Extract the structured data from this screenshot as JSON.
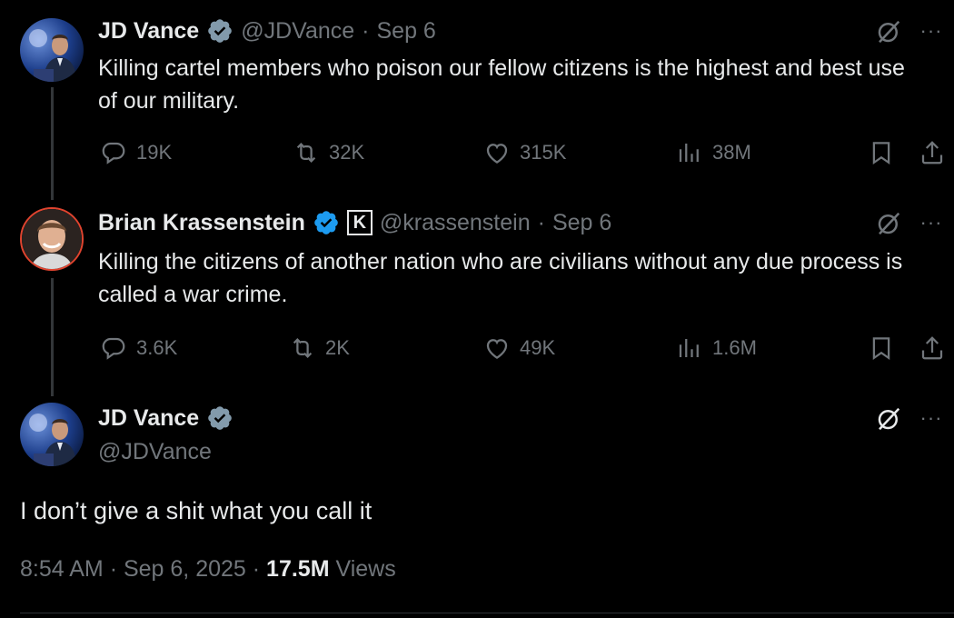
{
  "colors": {
    "background": "#000000",
    "text_primary": "#e7e9ea",
    "text_secondary": "#71767b",
    "verified_blue": "#1d9bf0",
    "verified_gray": "#829aab"
  },
  "tweets": [
    {
      "author_name": "JD Vance",
      "handle": "@JDVance",
      "separator": "·",
      "date": "Sep 6",
      "text": "Killing cartel members who poison our fellow citizens is the highest and best use of our military.",
      "replies": "19K",
      "retweets": "32K",
      "likes": "315K",
      "views": "38M"
    },
    {
      "author_name": "Brian Krassenstein",
      "handle": "@krassenstein",
      "separator": "·",
      "date": "Sep 6",
      "affiliate_badge": "K",
      "text": "Killing the citizens of another nation who are civilians without any due process is called a war crime.",
      "replies": "3.6K",
      "retweets": "2K",
      "likes": "49K",
      "views": "1.6M"
    }
  ],
  "main_tweet": {
    "author_name": "JD Vance",
    "handle": "@JDVance",
    "text": "I don’t give a shit what you call it",
    "time": "8:54 AM",
    "dot1": "·",
    "date": "Sep 6, 2025",
    "dot2": "·",
    "views_count": "17.5M",
    "views_label": "Views"
  },
  "icons": {
    "reply": "reply-icon",
    "retweet": "retweet-icon",
    "like": "heart-icon",
    "views": "views-icon",
    "bookmark": "bookmark-icon",
    "share": "share-icon",
    "grok": "grok-icon",
    "more": "more-icon"
  },
  "more_glyph": "···"
}
